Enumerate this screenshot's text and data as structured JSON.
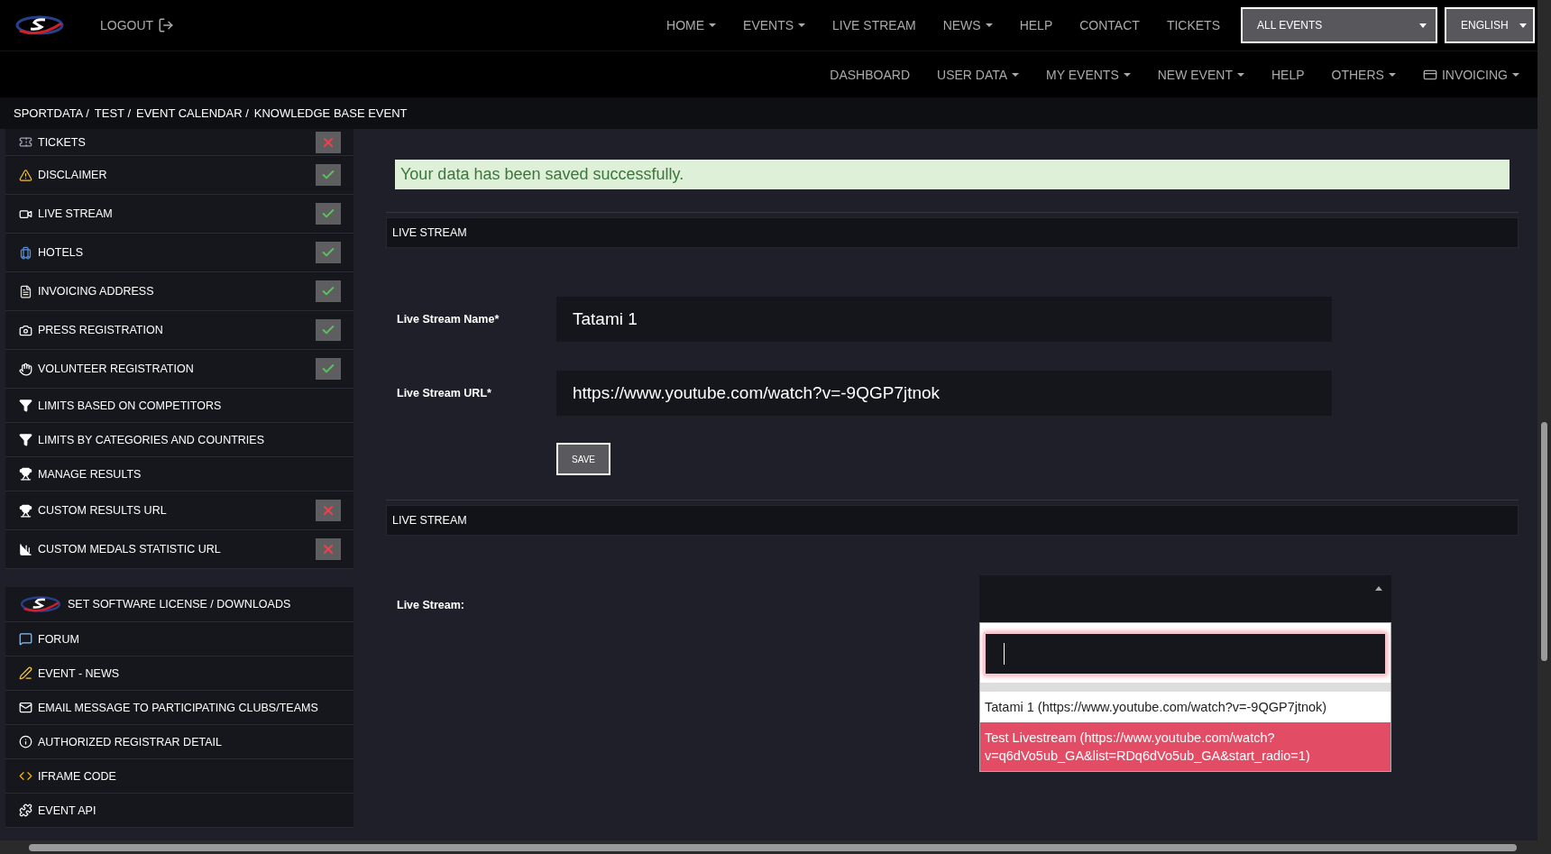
{
  "top_nav": {
    "logout": "LOGOUT",
    "items": [
      {
        "label": "HOME",
        "dropdown": true
      },
      {
        "label": "EVENTS",
        "dropdown": true
      },
      {
        "label": "LIVE STREAM",
        "dropdown": false
      },
      {
        "label": "NEWS",
        "dropdown": true
      },
      {
        "label": "HELP",
        "dropdown": false
      },
      {
        "label": "CONTACT",
        "dropdown": false
      },
      {
        "label": "TICKETS",
        "dropdown": false
      }
    ],
    "event_select": "ALL EVENTS",
    "language_select": "ENGLISH"
  },
  "sub_nav": [
    {
      "label": "DASHBOARD",
      "dropdown": false
    },
    {
      "label": "USER DATA",
      "dropdown": true
    },
    {
      "label": "MY EVENTS",
      "dropdown": true
    },
    {
      "label": "NEW EVENT",
      "dropdown": true
    },
    {
      "label": "HELP",
      "dropdown": false
    },
    {
      "label": "OTHERS",
      "dropdown": true
    },
    {
      "label": "INVOICING",
      "dropdown": true
    }
  ],
  "breadcrumb": [
    "SPORTDATA /",
    "TEST /",
    "EVENT CALENDAR /",
    "KNOWLEDGE BASE EVENT"
  ],
  "sidebar": {
    "items": [
      {
        "label": "TICKETS",
        "kind": "status",
        "complete": false
      },
      {
        "label": "DISCLAIMER",
        "kind": "status",
        "complete": true
      },
      {
        "label": "LIVE STREAM",
        "kind": "status",
        "complete": true
      },
      {
        "label": "HOTELS",
        "kind": "status",
        "complete": true
      },
      {
        "label": "INVOICING ADDRESS",
        "kind": "status",
        "complete": true
      },
      {
        "label": "PRESS REGISTRATION",
        "kind": "status",
        "complete": true
      },
      {
        "label": "VOLUNTEER REGISTRATION",
        "kind": "status",
        "complete": true
      },
      {
        "label": "LIMITS BASED ON COMPETITORS",
        "kind": "plain"
      },
      {
        "label": "LIMITS BY CATEGORIES AND COUNTRIES",
        "kind": "plain"
      },
      {
        "label": "MANAGE RESULTS",
        "kind": "plain"
      },
      {
        "label": "CUSTOM RESULTS URL",
        "kind": "status",
        "complete": false
      },
      {
        "label": "CUSTOM MEDALS STATISTIC URL",
        "kind": "status",
        "complete": false
      }
    ],
    "extra_items": [
      "SET SOFTWARE LICENSE / DOWNLOADS",
      "FORUM",
      "EVENT - NEWS",
      "EMAIL MESSAGE TO PARTICIPATING CLUBS/TEAMS",
      "AUTHORIZED REGISTRAR DETAIL",
      "IFRAME CODE",
      "EVENT API"
    ]
  },
  "alert": "Your data has been saved successfully.",
  "form_section": {
    "title": "LIVE STREAM",
    "fields": [
      {
        "label": "Live Stream Name*",
        "value": "Tatami 1"
      },
      {
        "label": "Live Stream URL*",
        "value": "https://www.youtube.com/watch?v=-9QGP7jtnok"
      }
    ],
    "save_button": "SAVE"
  },
  "select_section": {
    "title": "LIVE STREAM",
    "label": "Live Stream:",
    "options": [
      {
        "label": "Tatami 1 (https://www.youtube.com/watch?v=-9QGP7jtnok)",
        "selected": false
      },
      {
        "label": "Test Livestream (https://www.youtube.com/watch?v=q6dVo5ub_GA&list=RDq6dVo5ub_GA&start_radio=1)",
        "selected": true
      }
    ]
  }
}
